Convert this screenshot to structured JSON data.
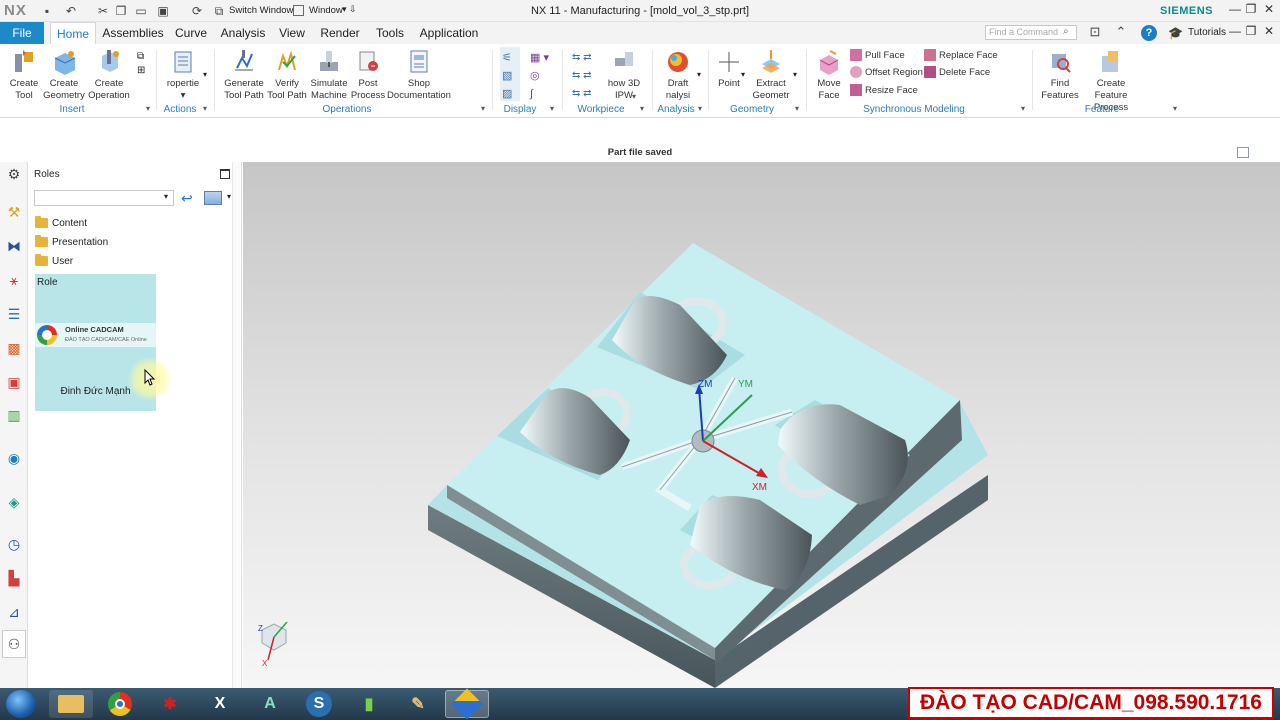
{
  "app": {
    "logo": "NX",
    "title": "NX 11 - Manufacturing - [mold_vol_3_stp.prt]",
    "brand": "SIEMENS",
    "switch_window": "Switch Window",
    "window_menu": "Window",
    "window_icons": [
      "minimize-icon",
      "restore-icon",
      "close-icon"
    ]
  },
  "tabs": {
    "file": "File",
    "home": "Home",
    "assemblies": "Assemblies",
    "curve": "Curve",
    "analysis": "Analysis",
    "view": "View",
    "render": "Render",
    "tools": "Tools",
    "application": "Application",
    "active": "Home"
  },
  "search": {
    "placeholder": "Find a Command"
  },
  "tutorials": "Tutorials",
  "ribbon": {
    "insert": {
      "label": "Insert",
      "create_tool": [
        "Create",
        "Tool"
      ],
      "create_geometry": [
        "Create",
        "Geometry"
      ],
      "create_operation": [
        "Create",
        "Operation"
      ]
    },
    "actions": {
      "label": "Actions",
      "properties": "ropertie"
    },
    "operations": {
      "label": "Operations",
      "generate": [
        "Generate",
        "Tool Path"
      ],
      "verify": [
        "Verify",
        "Tool Path"
      ],
      "simulate": [
        "Simulate",
        "Machine"
      ],
      "post": [
        "Post",
        "Process"
      ],
      "shop": [
        "Shop",
        "Documentation"
      ]
    },
    "display": {
      "label": "Display"
    },
    "workpiece": {
      "label": "Workpiece",
      "show3d": [
        "how 3D",
        "IPW"
      ]
    },
    "analysis": {
      "label": "Analysis",
      "draft": [
        "Draft",
        "nalysi"
      ]
    },
    "geometry": {
      "label": "Geometry",
      "point": "Point",
      "extract": [
        "Extract",
        "Geometr"
      ]
    },
    "sync": {
      "label": "Synchronous Modeling",
      "move_face": [
        "Move",
        "Face"
      ],
      "pull_face": "Pull Face",
      "offset_region": "Offset Region",
      "resize_face": "Resize Face",
      "replace_face": "Replace Face",
      "delete_face": "Delete Face"
    },
    "feature": {
      "label": "Feature",
      "find": [
        "Find",
        "Features"
      ],
      "create_process": [
        "Create Feature",
        "Process"
      ]
    }
  },
  "status": "Part file saved",
  "roles_panel": {
    "title": "Roles",
    "folders": [
      "Content",
      "Presentation",
      "User"
    ],
    "role_tile_title": "Role",
    "banner_name": "Online CADCAM",
    "banner_sub": "ĐÀO TẠO CAD/CAM/CAE Online",
    "role_name": "Đinh Đức Mạnh"
  },
  "viewport": {
    "axis_labels": {
      "zm": "ZM",
      "ym": "YM",
      "xm": "XM"
    },
    "triad": {
      "z": "Z",
      "x": "X"
    }
  },
  "taskbar": {
    "apps": [
      "windows-start",
      "file-explorer",
      "chrome",
      "autodesk",
      "xmind",
      "autocad",
      "solidworks",
      "excel-chart",
      "paint",
      "nx"
    ]
  },
  "watermark": "ĐÀO TẠO CAD/CAM_098.590.1716",
  "colors": {
    "accent": "#1c89c9",
    "part_top": "#c4ecef",
    "axis_z": "#1a3fb0",
    "axis_y": "#2aa14a",
    "axis_x": "#d0202a",
    "banner_red": "#c40000"
  }
}
